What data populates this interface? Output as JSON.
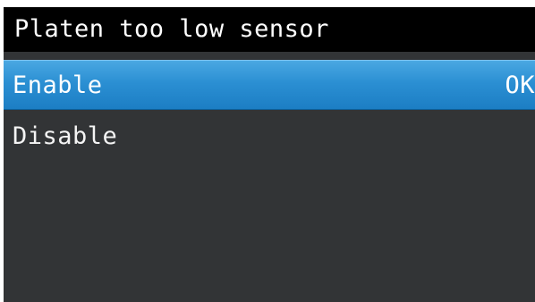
{
  "title": "Platen too low sensor",
  "menu": {
    "items": [
      {
        "label": "Enable",
        "badge": "OK",
        "selected": true
      },
      {
        "label": "Disable",
        "selected": false
      }
    ]
  },
  "colors": {
    "background": "#323436",
    "title_bar": "#000000",
    "selection": "#2b8fd3",
    "text": "#ffffff"
  }
}
